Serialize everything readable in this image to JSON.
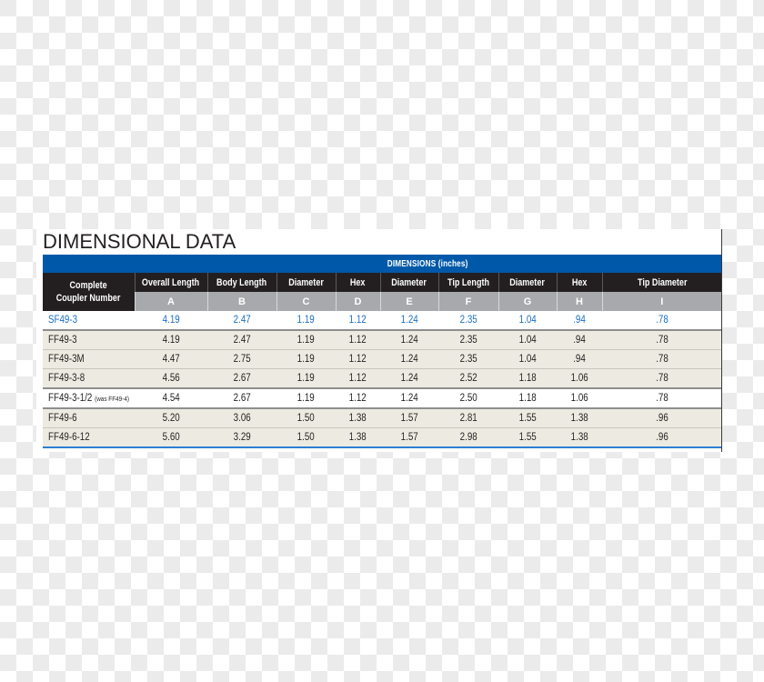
{
  "title": "DIMENSIONAL DATA",
  "table": {
    "group_header": "DIMENSIONS (inches)",
    "first_column_header": [
      "Complete",
      "Coupler Number"
    ],
    "columns": [
      {
        "label": "Overall Length",
        "letter": "A"
      },
      {
        "label": "Body Length",
        "letter": "B"
      },
      {
        "label": "Diameter",
        "letter": "C"
      },
      {
        "label": "Hex",
        "letter": "D"
      },
      {
        "label": "Diameter",
        "letter": "E"
      },
      {
        "label": "Tip Length",
        "letter": "F"
      },
      {
        "label": "Diameter",
        "letter": "G"
      },
      {
        "label": "Hex",
        "letter": "H"
      },
      {
        "label": "Tip Diameter",
        "letter": "I"
      }
    ],
    "rows": [
      {
        "part": "SF49-3",
        "note": "",
        "values": [
          "4.19",
          "2.47",
          "1.19",
          "1.12",
          "1.24",
          "2.35",
          "1.04",
          ".94",
          ".78"
        ]
      },
      {
        "part": "FF49-3",
        "note": "",
        "values": [
          "4.19",
          "2.47",
          "1.19",
          "1.12",
          "1.24",
          "2.35",
          "1.04",
          ".94",
          ".78"
        ]
      },
      {
        "part": "FF49-3M",
        "note": "",
        "values": [
          "4.47",
          "2.75",
          "1.19",
          "1.12",
          "1.24",
          "2.35",
          "1.04",
          ".94",
          ".78"
        ]
      },
      {
        "part": "FF49-3-8",
        "note": "",
        "values": [
          "4.56",
          "2.67",
          "1.19",
          "1.12",
          "1.24",
          "2.52",
          "1.18",
          "1.06",
          ".78"
        ]
      },
      {
        "part": "FF49-3-1/2",
        "note": "(was FF49-4)",
        "values": [
          "4.54",
          "2.67",
          "1.19",
          "1.12",
          "1.24",
          "2.50",
          "1.18",
          "1.06",
          ".78"
        ]
      },
      {
        "part": "FF49-6",
        "note": "",
        "values": [
          "5.20",
          "3.06",
          "1.50",
          "1.38",
          "1.57",
          "2.81",
          "1.55",
          "1.38",
          ".96"
        ]
      },
      {
        "part": "FF49-6-12",
        "note": "",
        "values": [
          "5.60",
          "3.29",
          "1.50",
          "1.38",
          "1.57",
          "2.98",
          "1.55",
          "1.38",
          ".96"
        ]
      }
    ]
  },
  "colors": {
    "band_blue": "#0059a8",
    "header_black": "#231f20",
    "subheader_gray": "#a7a9ac",
    "row_beige": "#edebe1",
    "highlight_text_blue": "#1b6fc0"
  }
}
